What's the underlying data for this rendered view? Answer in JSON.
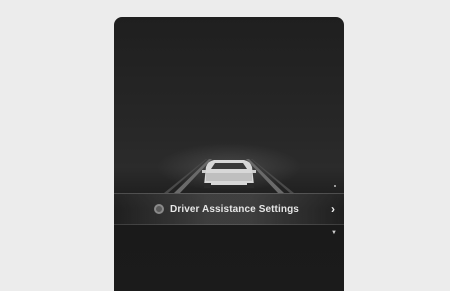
{
  "menu": {
    "item_label": "Driver Assistance Settings",
    "item_icon": "gear-icon",
    "chevron_icon": "chevron-right-icon",
    "scroll_down_icon": "caret-down-icon"
  },
  "colors": {
    "screen_background": "#1f1f1f",
    "page_background": "#ececec",
    "text": "#e6e6e6"
  }
}
